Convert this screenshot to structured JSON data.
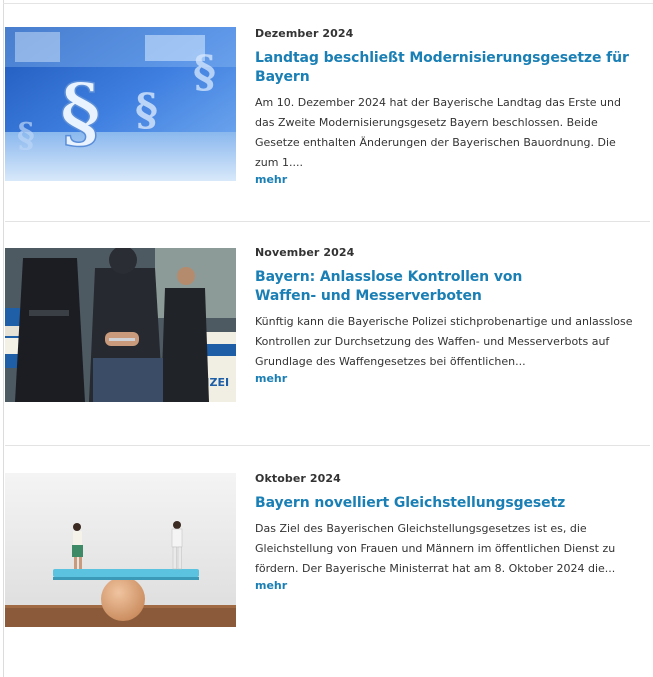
{
  "articles": [
    {
      "date": "Dezember 2024",
      "title": "Landtag beschließt Modernisierungsgesetze für Bayern",
      "excerpt": "Am 10. Dezember 2024 hat der Bayerische Landtag das Erste und das Zweite Modernisierungsgesetz Bayern beschlossen. Beide Gesetze enthalten Änderungen der Bayerischen Bauordnung. Die zum 1....",
      "more": "mehr",
      "image": "paragraph-sign-image"
    },
    {
      "date": "November 2024",
      "title": "Bayern: Anlasslose Kontrollen von Waffen- und Messerverboten",
      "excerpt": "Künftig kann die Bayerische Polizei stichprobenartige und anlasslose Kontrollen zur Durchsetzung des Waffen- und Messerverbots auf Grundlage des Waffengesetzes bei öffentlichen...",
      "more": "mehr",
      "image": "police-arrest-image",
      "image_text": "POLIZEI"
    },
    {
      "date": "Oktober 2024",
      "title": "Bayern novelliert Gleichstellungsgesetz",
      "excerpt": "Das Ziel des Bayerischen Gleichstellungsgesetzes ist es, die Gleichstellung von Frauen und Männern im öffentlichen Dienst zu fördern. Der Bayerische Ministerrat hat am 8. Oktober 2024 die...",
      "more": "mehr",
      "image": "seesaw-balance-image"
    }
  ],
  "colors": {
    "link": "#1a7fb5",
    "text": "#333333",
    "divider": "#e3e3e3"
  }
}
